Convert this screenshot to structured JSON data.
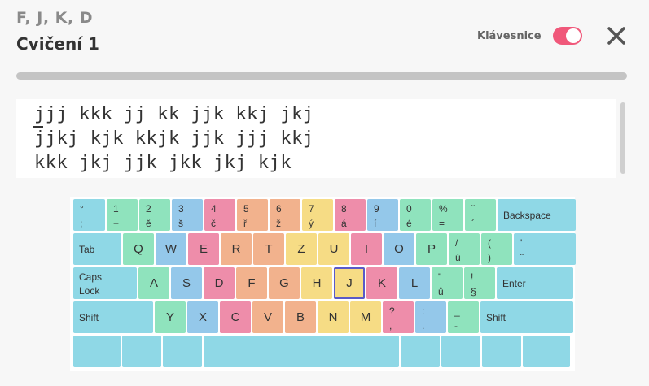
{
  "header": {
    "subtitle": "F, J, K, D",
    "title": "Cvičení 1",
    "keyboard_toggle_label": "Klávesnice",
    "keyboard_toggle_on": true
  },
  "progress": {
    "fraction": 0.0
  },
  "exercise": {
    "lines": [
      "jjj kkk jj kk jjk kkj jkj",
      "jjkj kjk kkjk jjk jjj kkj",
      "kkk jkj jjk jkk jkj kjk"
    ]
  },
  "keyboard": {
    "highlighted_key": "J",
    "rows": [
      [
        {
          "top": "°",
          "bottom": ";",
          "color": "cyan"
        },
        {
          "top": "1",
          "bottom": "+",
          "color": "green"
        },
        {
          "top": "2",
          "bottom": "ě",
          "color": "green"
        },
        {
          "top": "3",
          "bottom": "š",
          "color": "blue"
        },
        {
          "top": "4",
          "bottom": "č",
          "color": "pink"
        },
        {
          "top": "5",
          "bottom": "ř",
          "color": "orange"
        },
        {
          "top": "6",
          "bottom": "ž",
          "color": "orange"
        },
        {
          "top": "7",
          "bottom": "ý",
          "color": "yellow"
        },
        {
          "top": "8",
          "bottom": "á",
          "color": "pink"
        },
        {
          "top": "9",
          "bottom": "í",
          "color": "blue"
        },
        {
          "top": "0",
          "bottom": "é",
          "color": "green"
        },
        {
          "top": "%",
          "bottom": "=",
          "color": "green"
        },
        {
          "top": "ˇ",
          "bottom": "´",
          "color": "green"
        },
        {
          "label": "Backspace",
          "color": "cyan"
        }
      ],
      [
        {
          "label": "Tab",
          "color": "cyan"
        },
        {
          "center": "Q",
          "color": "green"
        },
        {
          "center": "W",
          "color": "blue"
        },
        {
          "center": "E",
          "color": "pink"
        },
        {
          "center": "R",
          "color": "orange"
        },
        {
          "center": "T",
          "color": "orange"
        },
        {
          "center": "Z",
          "color": "yellow"
        },
        {
          "center": "U",
          "color": "yellow"
        },
        {
          "center": "I",
          "color": "pink"
        },
        {
          "center": "O",
          "color": "blue"
        },
        {
          "center": "P",
          "color": "green"
        },
        {
          "top": "/",
          "bottom": "ú",
          "color": "green"
        },
        {
          "top": "(",
          "bottom": ")",
          "color": "green"
        },
        {
          "top": "'",
          "bottom": "¨",
          "color": "cyan"
        }
      ],
      [
        {
          "label": "Caps",
          "label2": "Lock",
          "color": "cyan"
        },
        {
          "center": "A",
          "color": "green"
        },
        {
          "center": "S",
          "color": "blue"
        },
        {
          "center": "D",
          "color": "pink"
        },
        {
          "center": "F",
          "color": "orange"
        },
        {
          "center": "G",
          "color": "orange"
        },
        {
          "center": "H",
          "color": "yellow"
        },
        {
          "center": "J",
          "color": "yellow"
        },
        {
          "center": "K",
          "color": "pink"
        },
        {
          "center": "L",
          "color": "blue"
        },
        {
          "top": "\"",
          "bottom": "ů",
          "color": "green"
        },
        {
          "top": "!",
          "bottom": "§",
          "color": "green"
        },
        {
          "label": "Enter",
          "color": "cyan"
        }
      ],
      [
        {
          "label": "Shift",
          "color": "cyan"
        },
        {
          "center": "Y",
          "color": "green"
        },
        {
          "center": "X",
          "color": "blue"
        },
        {
          "center": "C",
          "color": "pink"
        },
        {
          "center": "V",
          "color": "orange"
        },
        {
          "center": "B",
          "color": "orange"
        },
        {
          "center": "N",
          "color": "yellow"
        },
        {
          "center": "M",
          "color": "yellow"
        },
        {
          "top": "?",
          "bottom": ",",
          "color": "pink"
        },
        {
          "top": ":",
          "bottom": ".",
          "color": "blue"
        },
        {
          "top": "_",
          "bottom": "-",
          "color": "green"
        },
        {
          "label": "Shift",
          "color": "cyan"
        }
      ],
      [
        {
          "color": "cyan"
        },
        {
          "color": "cyan"
        },
        {
          "color": "cyan"
        },
        {
          "color": "cyan"
        },
        {
          "color": "cyan"
        },
        {
          "color": "cyan"
        },
        {
          "color": "cyan"
        },
        {
          "color": "cyan"
        }
      ]
    ]
  }
}
